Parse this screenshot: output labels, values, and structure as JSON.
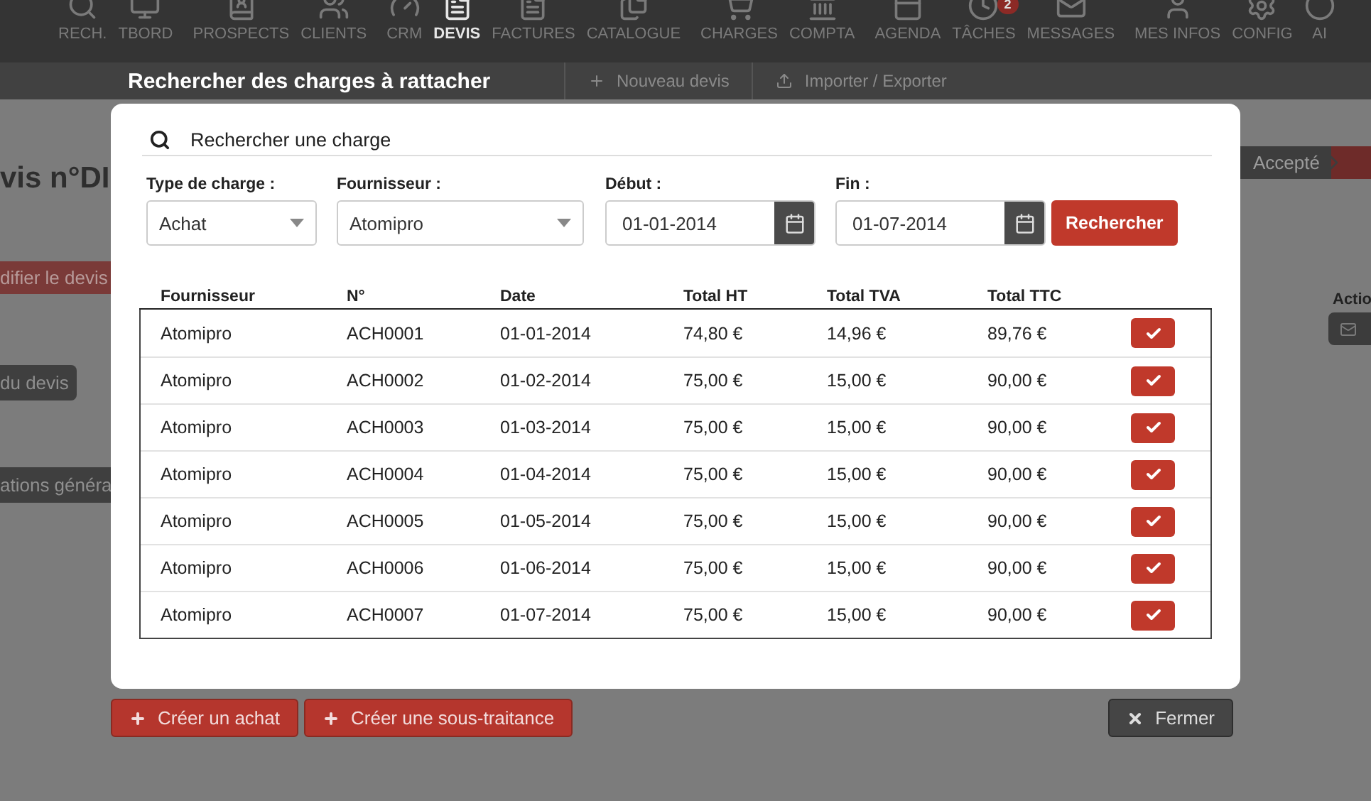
{
  "nav": {
    "groups": [
      [
        {
          "label": "RECH.",
          "selected": false
        },
        {
          "label": "TBORD",
          "selected": false
        }
      ],
      [
        {
          "label": "PROSPECTS",
          "selected": false
        },
        {
          "label": "CLIENTS",
          "selected": false
        }
      ],
      [
        {
          "label": "CRM",
          "selected": false
        },
        {
          "label": "DEVIS",
          "selected": true
        },
        {
          "label": "FACTURES",
          "selected": false
        },
        {
          "label": "CATALOGUE",
          "selected": false
        }
      ],
      [
        {
          "label": "CHARGES",
          "selected": false
        },
        {
          "label": "COMPTA",
          "selected": false
        }
      ],
      [
        {
          "label": "AGENDA",
          "selected": false
        },
        {
          "label": "TÂCHES",
          "selected": false,
          "badge": "2"
        },
        {
          "label": "MESSAGES",
          "selected": false
        }
      ],
      [
        {
          "label": "MES INFOS",
          "selected": false
        },
        {
          "label": "CONFIG",
          "selected": false
        },
        {
          "label": "AI",
          "selected": false
        }
      ]
    ]
  },
  "subnav": [
    {
      "label": "Nouveau devis",
      "kind": "new"
    },
    {
      "label": "Importer / Exporter",
      "kind": "import"
    }
  ],
  "page": {
    "heading": "vis n°DI",
    "edit_button": "difier le devis",
    "devis_button": "du devis",
    "section_tab": "ations généra",
    "status": "Accepté",
    "actions_label": "Actio"
  },
  "modal": {
    "title": "Rechercher des charges à rattacher",
    "search_title": "Rechercher une charge",
    "filters": {
      "type_label": "Type de charge :",
      "type_value": "Achat",
      "supplier_label": "Fournisseur :",
      "supplier_value": "Atomipro",
      "start_label": "Début :",
      "start_value": "01-01-2014",
      "end_label": "Fin :",
      "end_value": "01-07-2014",
      "search_button": "Rechercher"
    },
    "table": {
      "columns": [
        "Fournisseur",
        "N°",
        "Date",
        "Total HT",
        "Total TVA",
        "Total TTC"
      ],
      "rows": [
        [
          "Atomipro",
          "ACH0001",
          "01-01-2014",
          "74,80 €",
          "14,96 €",
          "89,76 €"
        ],
        [
          "Atomipro",
          "ACH0002",
          "01-02-2014",
          "75,00 €",
          "15,00 €",
          "90,00 €"
        ],
        [
          "Atomipro",
          "ACH0003",
          "01-03-2014",
          "75,00 €",
          "15,00 €",
          "90,00 €"
        ],
        [
          "Atomipro",
          "ACH0004",
          "01-04-2014",
          "75,00 €",
          "15,00 €",
          "90,00 €"
        ],
        [
          "Atomipro",
          "ACH0005",
          "01-05-2014",
          "75,00 €",
          "15,00 €",
          "90,00 €"
        ],
        [
          "Atomipro",
          "ACH0006",
          "01-06-2014",
          "75,00 €",
          "15,00 €",
          "90,00 €"
        ],
        [
          "Atomipro",
          "ACH0007",
          "01-07-2014",
          "75,00 €",
          "15,00 €",
          "90,00 €"
        ]
      ]
    },
    "footer": {
      "create_purchase": "Créer un achat",
      "create_subcontract": "Créer une sous-traitance",
      "close": "Fermer"
    }
  }
}
